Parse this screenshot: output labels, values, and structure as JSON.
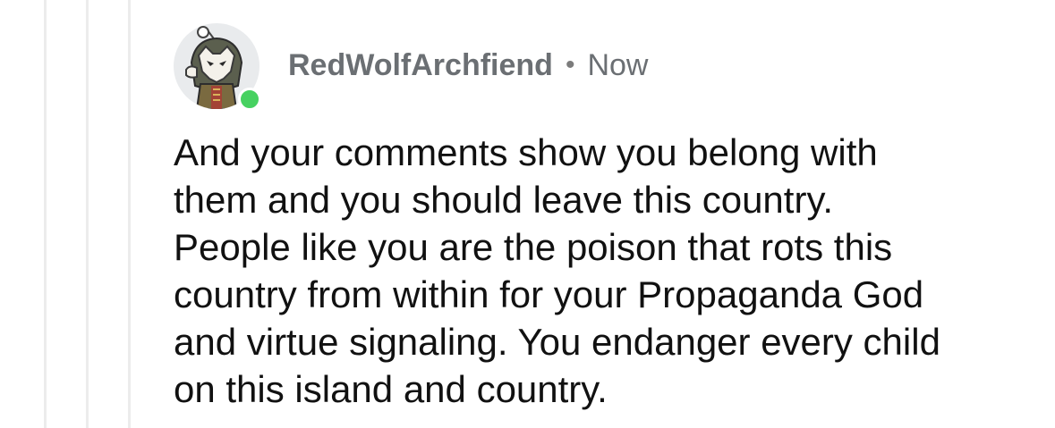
{
  "comment": {
    "username": "RedWolfArchfiend",
    "separator": "•",
    "timestamp": "Now",
    "body": "And your comments show you belong with\nthem and you should leave this country.\nPeople like you are the poison that rots this\ncountry from within for your Propaganda God\nand virtue signaling. You endanger every child\non this island and country.",
    "avatar_icon": "snoo-wolf-mask-avatar",
    "online_status_color": "#46d160"
  }
}
